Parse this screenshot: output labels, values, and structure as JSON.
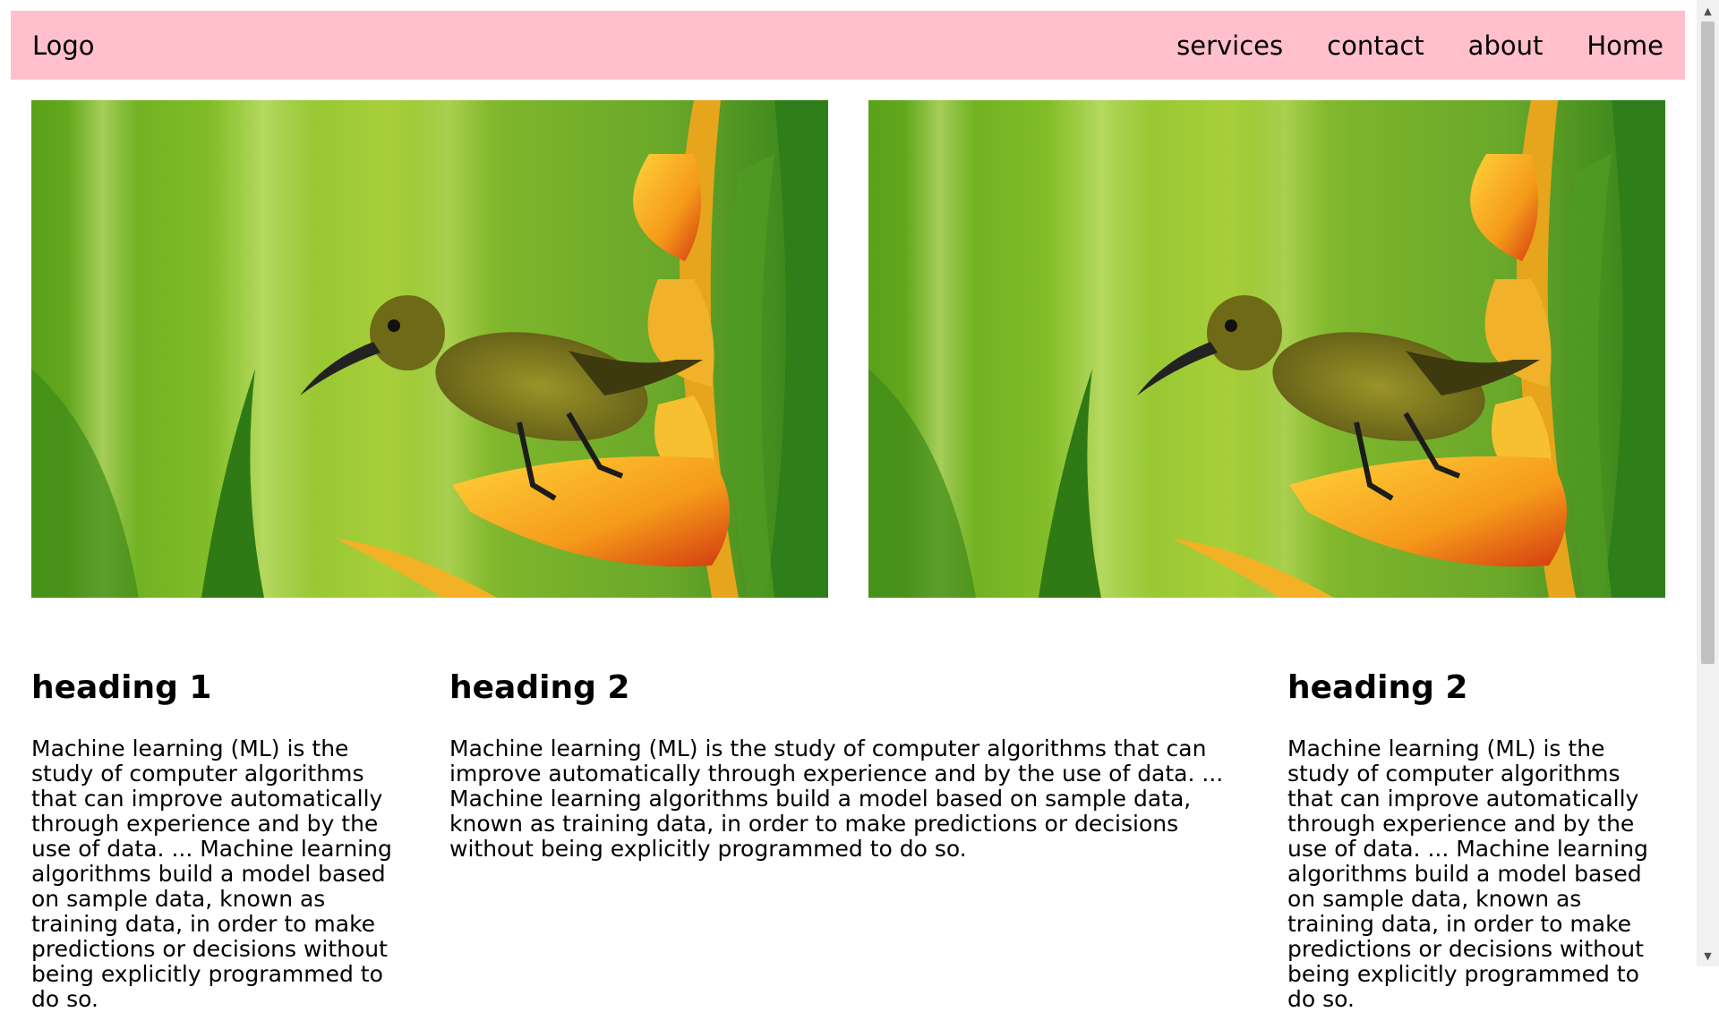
{
  "nav": {
    "logo": "Logo",
    "links": [
      "services",
      "contact",
      "about",
      "Home"
    ]
  },
  "images": [
    {
      "subject": "sunbird-on-heliconia-photo"
    },
    {
      "subject": "sunbird-on-heliconia-photo"
    }
  ],
  "columns": [
    {
      "heading": "heading 1",
      "text": "Machine learning (ML) is the study of computer algorithms that can improve automatically through experience and by the use of data. ... Machine learning algorithms build a model based on sample data, known as training data, in order to make predictions or decisions without being explicitly programmed to do so."
    },
    {
      "heading": "heading 2",
      "text": "Machine learning (ML) is the study of computer algorithms that can improve automatically through experience and by the use of data. ... Machine learning algorithms build a model based on sample data, known as training data, in order to make predictions or decisions without being explicitly programmed to do so."
    },
    {
      "heading": "heading 2",
      "text": "Machine learning (ML) is the study of computer algorithms that can improve automatically through experience and by the use of data. ... Machine learning algorithms build a model based on sample data, known as training data, in order to make predictions or decisions without being explicitly programmed to do so."
    }
  ],
  "colors": {
    "navbar_bg": "#ffc0cb",
    "page_bg": "#ffffff"
  }
}
